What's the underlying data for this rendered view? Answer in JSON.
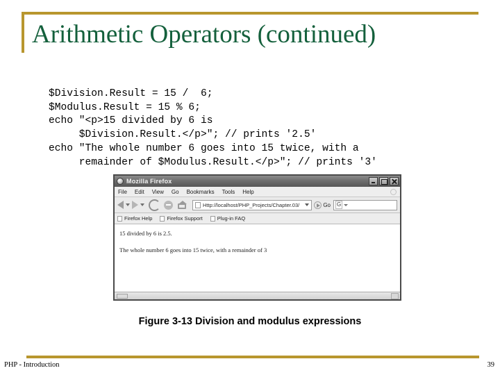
{
  "slide": {
    "title": "Arithmetic Operators (continued)",
    "accent_color": "#b8962e",
    "title_color": "#14603c"
  },
  "code_block": {
    "language": "php",
    "text": "$Division.Result = 15 /  6;\n$Modulus.Result = 15 % 6;\necho \"<p>15 divided by 6 is\n     $Division.Result.</p>\"; // prints '2.5'\necho \"The whole number 6 goes into 15 twice, with a\n     remainder of $Modulus.Result.</p>\"; // prints '3'"
  },
  "browser": {
    "title": "Mozilla Firefox",
    "app_icon": "firefox-icon",
    "window_buttons": {
      "minimize": "minimize-icon",
      "maximize": "maximize-icon",
      "close": "close-icon"
    },
    "menus": [
      "File",
      "Edit",
      "View",
      "Go",
      "Bookmarks",
      "Tools",
      "Help"
    ],
    "toolbar": {
      "back_icon": "back-arrow-icon",
      "forward_icon": "forward-arrow-icon",
      "reload_icon": "reload-icon",
      "stop_icon": "stop-icon",
      "home_icon": "home-icon",
      "url": "Http://localhost/PHP_Projects/Chapter.03/",
      "go_label": "Go",
      "search_engine_icon": "google-icon",
      "search_value": ""
    },
    "bookmarks": [
      "Firefox Help",
      "Firefox Support",
      "Plug-in FAQ"
    ],
    "content": {
      "paragraphs": [
        "15 divided by 6 is 2.5.",
        "The whole number 6 goes into 15 twice, with a remainder of 3"
      ]
    }
  },
  "figure": {
    "caption": "Figure 3-13  Division and modulus expressions"
  },
  "footer": {
    "left": "PHP - Introduction",
    "page_number": "39"
  }
}
